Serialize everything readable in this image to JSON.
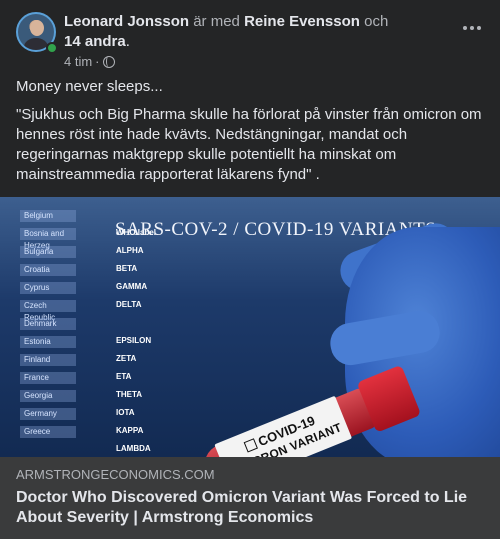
{
  "post": {
    "author": "Leonard Jonsson",
    "with_text": "är med",
    "tagged": "Reine Evensson",
    "and_text": "och",
    "others": "14 andra",
    "others_suffix": ".",
    "timestamp": "4 tim",
    "separator": "·",
    "paragraph1": "Money never sleeps...",
    "paragraph2": "\"Sjukhus och Big Pharma skulle ha förlorat på vinster från omicron om hennes röst inte hade kvävts. Nedstängningar, mandat och regeringarnas maktgrepp skulle potentiellt ha minskat om mainstreammedia rapporterat läkarens fynd\" ."
  },
  "image": {
    "title": "SARS-COV-2 / COVID-19 VARIANTS",
    "tube_line1": "COVID-19",
    "tube_line2": "OMICRON VARIANT",
    "rows": [
      {
        "country": "Belgium",
        "variant": ""
      },
      {
        "country": "Bosnia and Herzeg",
        "variant": "WHO label"
      },
      {
        "country": "Bulgaria",
        "variant": "ALPHA"
      },
      {
        "country": "Croatia",
        "variant": "BETA"
      },
      {
        "country": "Cyprus",
        "variant": "GAMMA"
      },
      {
        "country": "Czech Republic",
        "variant": "DELTA"
      },
      {
        "country": "Denmark",
        "variant": ""
      },
      {
        "country": "Estonia",
        "variant": "EPSILON"
      },
      {
        "country": "Finland",
        "variant": "ZETA"
      },
      {
        "country": "France",
        "variant": "ETA"
      },
      {
        "country": "Georgia",
        "variant": "THETA"
      },
      {
        "country": "Germany",
        "variant": "IOTA"
      },
      {
        "country": "Greece",
        "variant": "KAPPA"
      },
      {
        "country": "",
        "variant": "LAMBDA"
      }
    ]
  },
  "link": {
    "domain": "ARMSTRONGECONOMICS.COM",
    "title": "Doctor Who Discovered Omicron Variant Was Forced to Lie About Severity | Armstrong Economics"
  }
}
